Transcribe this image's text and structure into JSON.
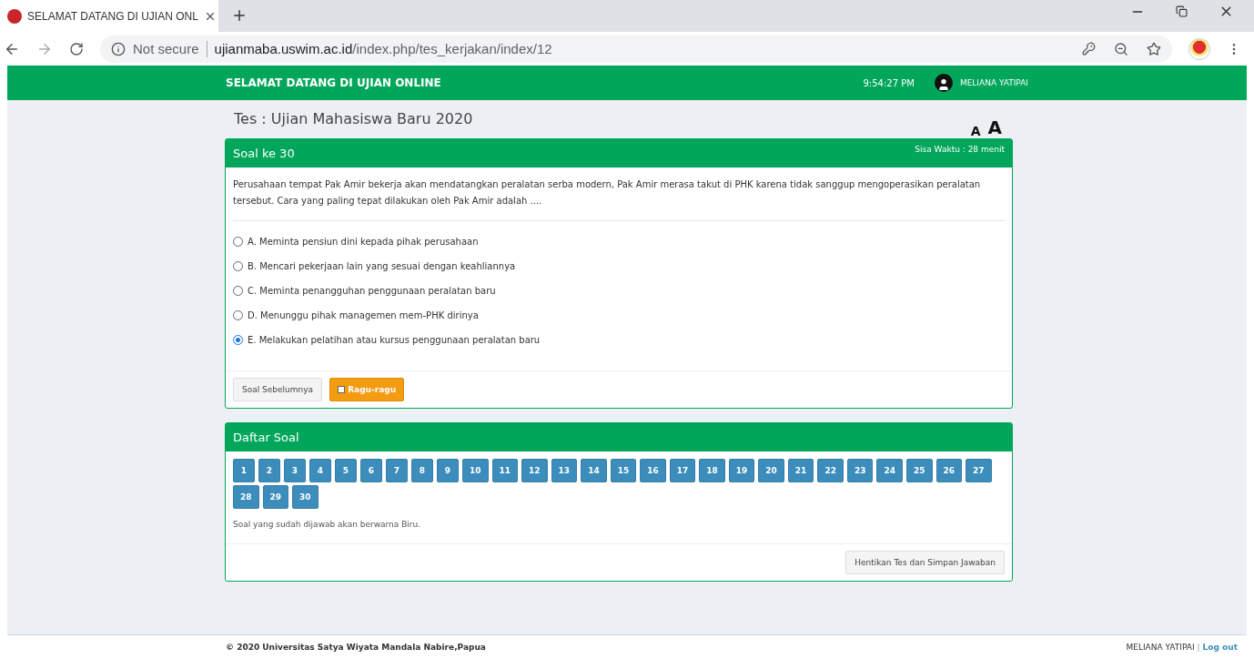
{
  "browser": {
    "tab_title": "SELAMAT DATANG DI UJIAN ONL",
    "security": "Not secure",
    "url_host": "ujianmaba.uswim.ac.id",
    "url_path": "/index.php/tes_kerjakan/index/12"
  },
  "header": {
    "title": "SELAMAT DATANG DI UJIAN ONLINE",
    "clock": "9:54:27 PM",
    "user": "MELIANA YATIPAI"
  },
  "test_title": "Tes : Ujian Mahasiswa Baru 2020",
  "font_sizes": [
    "A",
    "A"
  ],
  "question": {
    "heading": "Soal ke 30",
    "time_left": "Sisa Waktu : 28 menit",
    "text": "Perusahaan tempat Pak Amir bekerja akan mendatangkan peralatan serba modern, Pak Amir merasa takut di PHK karena tidak sanggup mengoperasikan peralatan tersebut. Cara yang paling tepat dilakukan oleh Pak Amir adalah ....",
    "options": [
      {
        "label": "A. Meminta pensiun dini kepada pihak perusahaan",
        "selected": false
      },
      {
        "label": "B. Mencari pekerjaan lain yang sesuai dengan keahliannya",
        "selected": false
      },
      {
        "label": "C. Meminta penangguhan penggunaan peralatan baru",
        "selected": false
      },
      {
        "label": "D. Menunggu pihak managemen mem-PHK dirinya",
        "selected": false
      },
      {
        "label": "E. Melakukan pelatihan atau kursus penggunaan peralatan baru",
        "selected": true
      }
    ],
    "prev_button": "Soal Sebelumnya",
    "doubt": {
      "label": "Ragu-ragu",
      "checked": false
    }
  },
  "list": {
    "heading": "Daftar Soal",
    "numbers": [
      {
        "label": "1",
        "answered": true
      },
      {
        "label": "2",
        "answered": true
      },
      {
        "label": "3",
        "answered": true
      },
      {
        "label": "4",
        "answered": true
      },
      {
        "label": "5",
        "answered": true
      },
      {
        "label": "6",
        "answered": true
      },
      {
        "label": "7",
        "answered": true
      },
      {
        "label": "8",
        "answered": true
      },
      {
        "label": "9",
        "answered": true
      },
      {
        "label": "10",
        "answered": true
      },
      {
        "label": "11",
        "answered": true
      },
      {
        "label": "12",
        "answered": true
      },
      {
        "label": "13",
        "answered": true
      },
      {
        "label": "14",
        "answered": true
      },
      {
        "label": "15",
        "answered": true
      },
      {
        "label": "16",
        "answered": true
      },
      {
        "label": "17",
        "answered": true
      },
      {
        "label": "18",
        "answered": true
      },
      {
        "label": "19",
        "answered": true
      },
      {
        "label": "20",
        "answered": true
      },
      {
        "label": "21",
        "answered": true
      },
      {
        "label": "22",
        "answered": true
      },
      {
        "label": "23",
        "answered": true
      },
      {
        "label": "24",
        "answered": true
      },
      {
        "label": "25",
        "answered": true
      },
      {
        "label": "26",
        "answered": true
      },
      {
        "label": "27",
        "answered": true
      },
      {
        "label": "28",
        "answered": true
      },
      {
        "label": "29",
        "answered": true
      },
      {
        "label": "30",
        "answered": true
      }
    ],
    "note": "Soal yang sudah dijawab akan berwarna Biru.",
    "stop_button": "Hentikan Tes dan Simpan Jawaban"
  },
  "footer": {
    "copyright": "© 2020 Universitas Satya Wiyata Mandala Nabire,Papua",
    "user": "MELIANA YATIPAI",
    "separator": "|",
    "logout": "Log out"
  }
}
